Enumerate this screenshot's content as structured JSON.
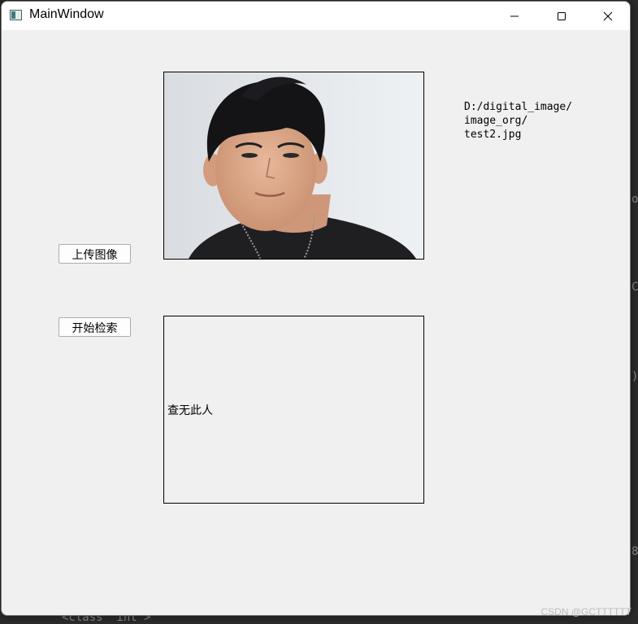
{
  "window": {
    "title": "MainWindow"
  },
  "controls": {
    "minimize_icon": "minimize-icon",
    "maximize_icon": "maximize-icon",
    "close_icon": "close-icon"
  },
  "buttons": {
    "upload": "上传图像",
    "search": "开始检索"
  },
  "image_path": "D:/digital_image/\nimage_org/\ntest2.jpg",
  "result_text": "查无此人",
  "background_code": "<class 'int'>",
  "watermark": "CSDN @GCTTTTTT"
}
